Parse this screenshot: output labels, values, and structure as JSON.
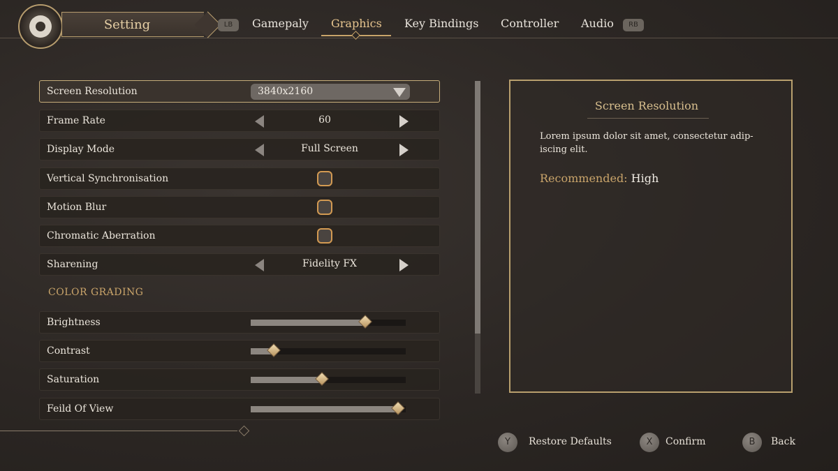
{
  "header": {
    "title": "Setting",
    "lb_badge": "LB",
    "rb_badge": "RB",
    "tabs": [
      {
        "label": "Gamepaly",
        "active": false
      },
      {
        "label": "Graphics",
        "active": true
      },
      {
        "label": "Key Bindings",
        "active": false
      },
      {
        "label": "Controller",
        "active": false
      },
      {
        "label": "Audio",
        "active": false
      }
    ]
  },
  "settings": {
    "screen_resolution": {
      "label": "Screen Resolution",
      "value": "3840x2160"
    },
    "frame_rate": {
      "label": "Frame Rate",
      "value": "60"
    },
    "display_mode": {
      "label": "Display Mode",
      "value": "Full Screen"
    },
    "vsync": {
      "label": "Vertical Synchronisation",
      "checked": false
    },
    "motion_blur": {
      "label": "Motion Blur",
      "checked": false
    },
    "chromatic_aberration": {
      "label": "Chromatic Aberration",
      "checked": false
    },
    "sharpening": {
      "label": "Sharening",
      "value": "Fidelity FX"
    }
  },
  "color_grading": {
    "title": "COLOR GRADING",
    "sliders": [
      {
        "label": "Brightness",
        "value": 0.74
      },
      {
        "label": "Contrast",
        "value": 0.15
      },
      {
        "label": "Saturation",
        "value": 0.46
      },
      {
        "label": "Feild Of View",
        "value": 0.95
      }
    ]
  },
  "info": {
    "title": "Screen Resolution",
    "description": "Lorem ipsum dolor sit amet, consectetur adip-iscing elit.",
    "recommended_label": "Recommended:",
    "recommended_value": "High"
  },
  "footer": {
    "restore": {
      "button": "Y",
      "label": "Restore Defaults"
    },
    "confirm": {
      "button": "X",
      "label": "Confirm"
    },
    "back": {
      "button": "B",
      "label": "Back"
    }
  },
  "colors": {
    "accent": "#c9a46a",
    "checkbox_border": "#d39a52"
  }
}
